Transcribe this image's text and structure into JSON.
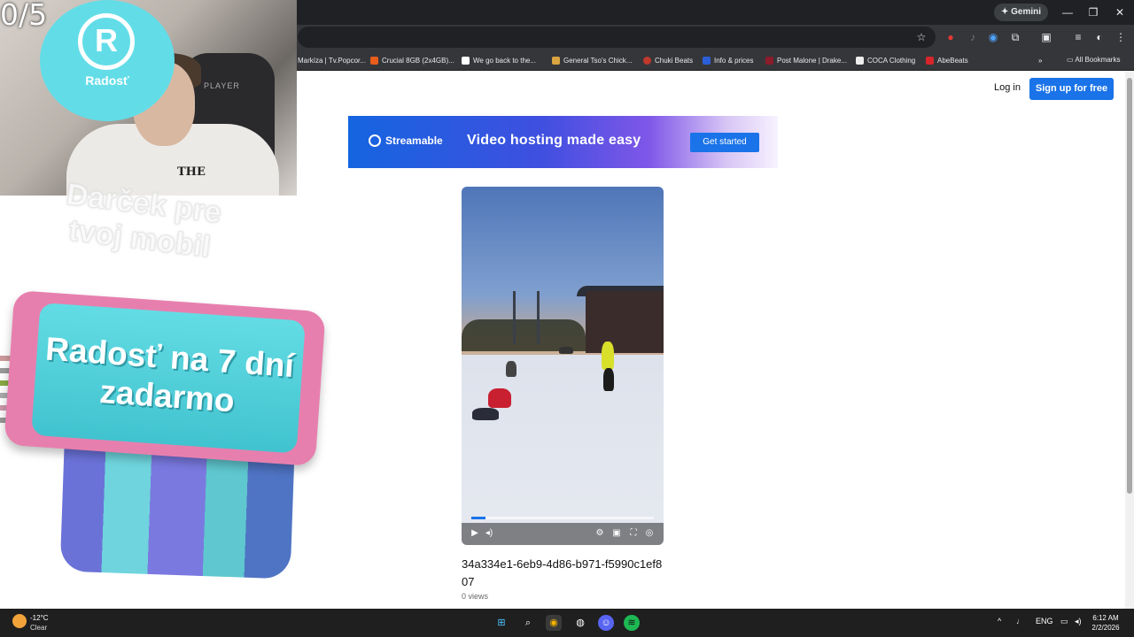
{
  "browser": {
    "gemini_label": "✦ Gemini",
    "window_controls": [
      "—",
      "❐",
      "✕"
    ],
    "bookmarks": [
      {
        "label": "Markíza | Tv.Popcor...",
        "color": "#e6322e"
      },
      {
        "label": "Crucial 8GB (2x4GB)...",
        "color": "#e85c1c"
      },
      {
        "label": "We go back to the...",
        "color": "#4285f4"
      },
      {
        "label": "General Tso's Chick...",
        "color": "#d9a441"
      },
      {
        "label": "Chuki Beats",
        "color": "#c0392b"
      },
      {
        "label": "Info & prices",
        "color": "#2b5fd9"
      },
      {
        "label": "Post Malone | Drake...",
        "color": "#8a1c2b"
      },
      {
        "label": "COCA Clothing",
        "color": "#111111"
      },
      {
        "label": "AbeBeats",
        "color": "#d7262b"
      }
    ],
    "all_bookmarks": "All Bookmarks"
  },
  "page": {
    "login": "Log in",
    "signup": "Sign up for free",
    "banner": {
      "brand": "Streamable",
      "tagline": "Video hosting made easy",
      "cta": "Get started"
    },
    "video": {
      "title": "34a334e1-6eb9-4d86-b971-f5990c1ef807",
      "views": "0 views",
      "progress": 0.08
    }
  },
  "overlay": {
    "counter": "0/5",
    "brand_mark": "R",
    "brand_word": "Radosť",
    "shirt_text": "THE",
    "chair_text": "PLAYER",
    "ghost_text": "Darček pre tvoj mobil",
    "promo_text": "Radosť na 7 dní zadarmo"
  },
  "taskbar": {
    "temperature": "-12°C",
    "condition": "Clear",
    "language": "ENG",
    "time": "6:12 AM",
    "date": "2/2/2026"
  }
}
